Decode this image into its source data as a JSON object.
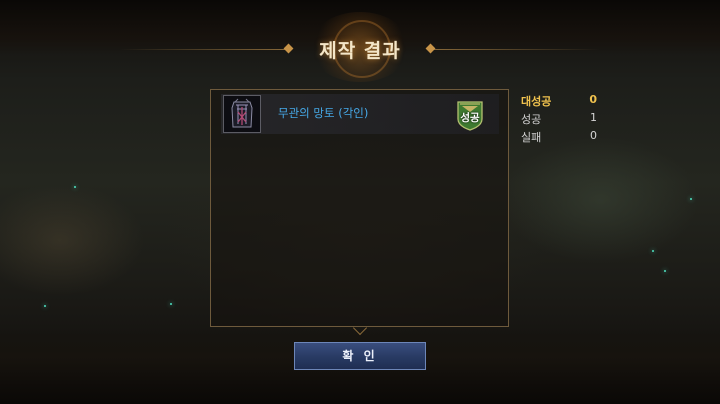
{
  "window": {
    "title": "제작 결과"
  },
  "result_list": {
    "items": [
      {
        "name": "무관의 망토 (각인)",
        "status": "성공",
        "status_color": "#2f7a2c",
        "icon": "cloak-icon"
      }
    ]
  },
  "stats": {
    "great_success": {
      "label": "대성공",
      "value": "0",
      "color": "#f0c24e"
    },
    "success": {
      "label": "성공",
      "value": "1"
    },
    "failure": {
      "label": "실패",
      "value": "0"
    }
  },
  "buttons": {
    "confirm": "확 인"
  },
  "colors": {
    "title": "#f4e6c8",
    "item_name": "#46a9e8",
    "button": "#283a63",
    "panel_border": "#6e5a3c"
  }
}
